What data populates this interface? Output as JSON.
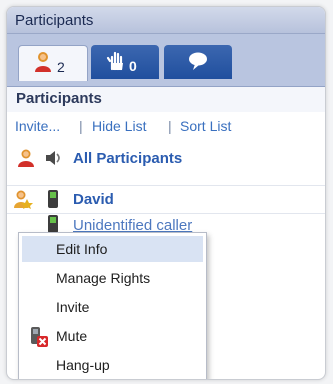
{
  "panel": {
    "title": "Participants"
  },
  "tabs": [
    {
      "icon": "participants-icon",
      "count": "2"
    },
    {
      "icon": "raised-hand-icon",
      "count": "0"
    },
    {
      "icon": "chat-bubble-icon",
      "count": ""
    }
  ],
  "section": {
    "header": "Participants"
  },
  "links": {
    "invite": "Invite...",
    "sep": "|",
    "hide": "Hide List",
    "sort": "Sort List"
  },
  "list": {
    "all": "All Participants",
    "rows": [
      {
        "name": "David"
      },
      {
        "name": "Unidentified caller"
      }
    ]
  },
  "context_menu": {
    "items": [
      {
        "label": "Edit Info",
        "highlighted": true
      },
      {
        "label": "Manage Rights"
      },
      {
        "label": "Invite"
      },
      {
        "label": "Mute",
        "icon": "mute-icon"
      },
      {
        "label": "Hang-up"
      }
    ]
  },
  "colors": {
    "header_blue": "#2b5cb0",
    "tab_blue": "#204f9e",
    "link_blue": "#3a70bf"
  }
}
